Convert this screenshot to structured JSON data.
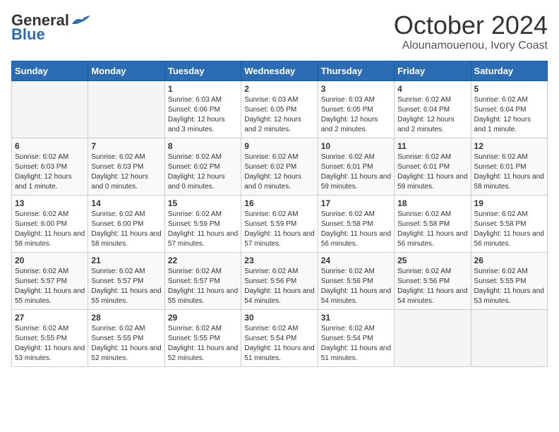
{
  "header": {
    "logo_general": "General",
    "logo_blue": "Blue",
    "month": "October 2024",
    "location": "Alounamouenou, Ivory Coast"
  },
  "days_of_week": [
    "Sunday",
    "Monday",
    "Tuesday",
    "Wednesday",
    "Thursday",
    "Friday",
    "Saturday"
  ],
  "weeks": [
    [
      {
        "day": "",
        "info": ""
      },
      {
        "day": "",
        "info": ""
      },
      {
        "day": "1",
        "info": "Sunrise: 6:03 AM\nSunset: 6:06 PM\nDaylight: 12 hours and 3 minutes."
      },
      {
        "day": "2",
        "info": "Sunrise: 6:03 AM\nSunset: 6:05 PM\nDaylight: 12 hours and 2 minutes."
      },
      {
        "day": "3",
        "info": "Sunrise: 6:03 AM\nSunset: 6:05 PM\nDaylight: 12 hours and 2 minutes."
      },
      {
        "day": "4",
        "info": "Sunrise: 6:02 AM\nSunset: 6:04 PM\nDaylight: 12 hours and 2 minutes."
      },
      {
        "day": "5",
        "info": "Sunrise: 6:02 AM\nSunset: 6:04 PM\nDaylight: 12 hours and 1 minute."
      }
    ],
    [
      {
        "day": "6",
        "info": "Sunrise: 6:02 AM\nSunset: 6:03 PM\nDaylight: 12 hours and 1 minute."
      },
      {
        "day": "7",
        "info": "Sunrise: 6:02 AM\nSunset: 6:03 PM\nDaylight: 12 hours and 0 minutes."
      },
      {
        "day": "8",
        "info": "Sunrise: 6:02 AM\nSunset: 6:02 PM\nDaylight: 12 hours and 0 minutes."
      },
      {
        "day": "9",
        "info": "Sunrise: 6:02 AM\nSunset: 6:02 PM\nDaylight: 12 hours and 0 minutes."
      },
      {
        "day": "10",
        "info": "Sunrise: 6:02 AM\nSunset: 6:01 PM\nDaylight: 11 hours and 59 minutes."
      },
      {
        "day": "11",
        "info": "Sunrise: 6:02 AM\nSunset: 6:01 PM\nDaylight: 11 hours and 59 minutes."
      },
      {
        "day": "12",
        "info": "Sunrise: 6:02 AM\nSunset: 6:01 PM\nDaylight: 11 hours and 58 minutes."
      }
    ],
    [
      {
        "day": "13",
        "info": "Sunrise: 6:02 AM\nSunset: 6:00 PM\nDaylight: 11 hours and 58 minutes."
      },
      {
        "day": "14",
        "info": "Sunrise: 6:02 AM\nSunset: 6:00 PM\nDaylight: 11 hours and 58 minutes."
      },
      {
        "day": "15",
        "info": "Sunrise: 6:02 AM\nSunset: 5:59 PM\nDaylight: 11 hours and 57 minutes."
      },
      {
        "day": "16",
        "info": "Sunrise: 6:02 AM\nSunset: 5:59 PM\nDaylight: 11 hours and 57 minutes."
      },
      {
        "day": "17",
        "info": "Sunrise: 6:02 AM\nSunset: 5:58 PM\nDaylight: 11 hours and 56 minutes."
      },
      {
        "day": "18",
        "info": "Sunrise: 6:02 AM\nSunset: 5:58 PM\nDaylight: 11 hours and 56 minutes."
      },
      {
        "day": "19",
        "info": "Sunrise: 6:02 AM\nSunset: 5:58 PM\nDaylight: 11 hours and 56 minutes."
      }
    ],
    [
      {
        "day": "20",
        "info": "Sunrise: 6:02 AM\nSunset: 5:57 PM\nDaylight: 11 hours and 55 minutes."
      },
      {
        "day": "21",
        "info": "Sunrise: 6:02 AM\nSunset: 5:57 PM\nDaylight: 11 hours and 55 minutes."
      },
      {
        "day": "22",
        "info": "Sunrise: 6:02 AM\nSunset: 5:57 PM\nDaylight: 11 hours and 55 minutes."
      },
      {
        "day": "23",
        "info": "Sunrise: 6:02 AM\nSunset: 5:56 PM\nDaylight: 11 hours and 54 minutes."
      },
      {
        "day": "24",
        "info": "Sunrise: 6:02 AM\nSunset: 5:56 PM\nDaylight: 11 hours and 54 minutes."
      },
      {
        "day": "25",
        "info": "Sunrise: 6:02 AM\nSunset: 5:56 PM\nDaylight: 11 hours and 54 minutes."
      },
      {
        "day": "26",
        "info": "Sunrise: 6:02 AM\nSunset: 5:55 PM\nDaylight: 11 hours and 53 minutes."
      }
    ],
    [
      {
        "day": "27",
        "info": "Sunrise: 6:02 AM\nSunset: 5:55 PM\nDaylight: 11 hours and 53 minutes."
      },
      {
        "day": "28",
        "info": "Sunrise: 6:02 AM\nSunset: 5:55 PM\nDaylight: 11 hours and 52 minutes."
      },
      {
        "day": "29",
        "info": "Sunrise: 6:02 AM\nSunset: 5:55 PM\nDaylight: 11 hours and 52 minutes."
      },
      {
        "day": "30",
        "info": "Sunrise: 6:02 AM\nSunset: 5:54 PM\nDaylight: 11 hours and 51 minutes."
      },
      {
        "day": "31",
        "info": "Sunrise: 6:02 AM\nSunset: 5:54 PM\nDaylight: 11 hours and 51 minutes."
      },
      {
        "day": "",
        "info": ""
      },
      {
        "day": "",
        "info": ""
      }
    ]
  ]
}
